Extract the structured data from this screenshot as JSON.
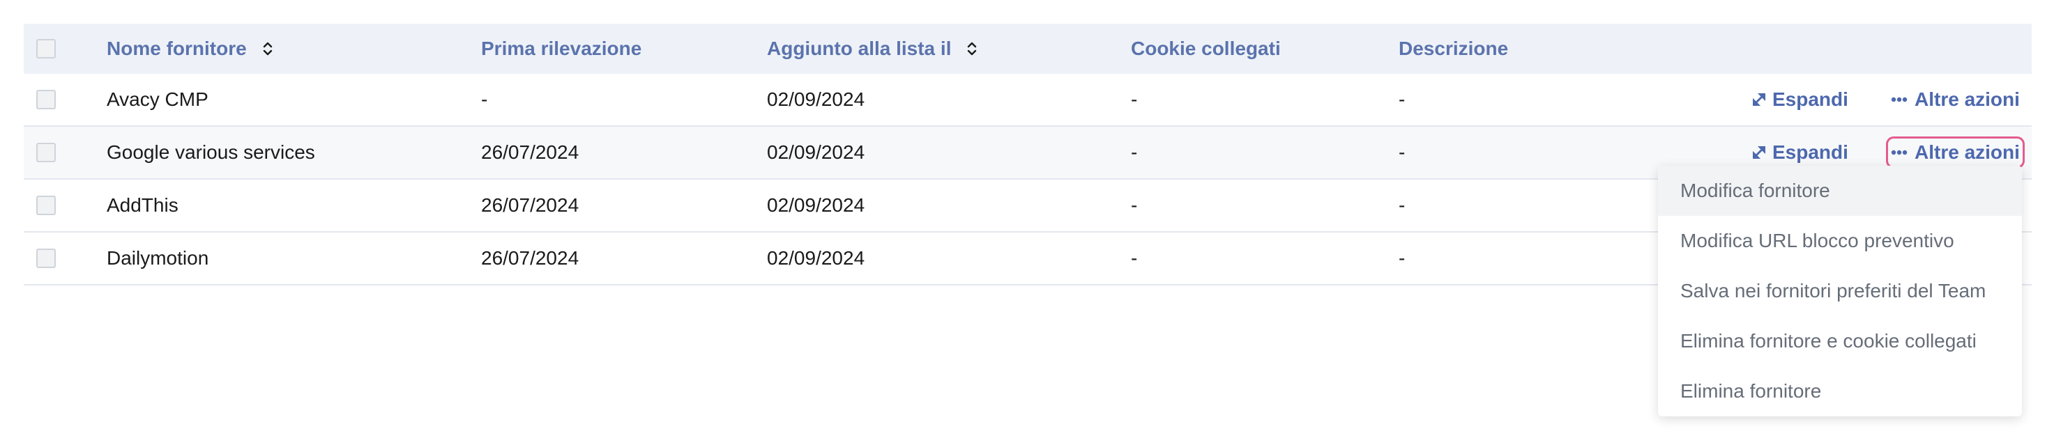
{
  "header": {
    "col_name": "Nome fornitore",
    "col_first_seen": "Prima rilevazione",
    "col_added": "Aggiunto alla lista il",
    "col_cookies": "Cookie collegati",
    "col_description": "Descrizione"
  },
  "rows": [
    {
      "name": "Avacy CMP",
      "first_seen": "-",
      "added": "02/09/2024",
      "cookies": "-",
      "description": "-",
      "expand_label": "Espandi",
      "more_label": "Altre azioni"
    },
    {
      "name": "Google various services",
      "first_seen": "26/07/2024",
      "added": "02/09/2024",
      "cookies": "-",
      "description": "-",
      "expand_label": "Espandi",
      "more_label": "Altre azioni"
    },
    {
      "name": "AddThis",
      "first_seen": "26/07/2024",
      "added": "02/09/2024",
      "cookies": "-",
      "description": "-"
    },
    {
      "name": "Dailymotion",
      "first_seen": "26/07/2024",
      "added": "02/09/2024",
      "cookies": "-",
      "description": "-"
    }
  ],
  "dropdown": {
    "items": [
      "Modifica fornitore",
      "Modifica URL blocco preventivo",
      "Salva nei fornitori preferiti del Team",
      "Elimina fornitore e cookie collegati",
      "Elimina fornitore"
    ]
  },
  "colors": {
    "accent": "#4d68ad",
    "header_bg": "#eef2f8",
    "focus": "#e35c8f"
  }
}
